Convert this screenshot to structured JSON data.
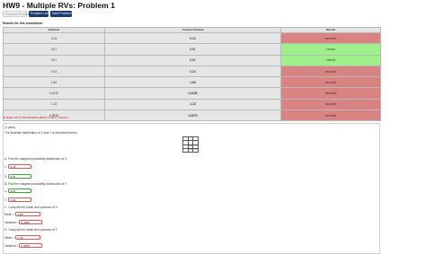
{
  "page": {
    "title": "HW9 - Multiple RVs: Problem 1"
  },
  "nav": {
    "previous_label": "Previous Problem",
    "list_label": "Problem List",
    "next_label": "Next Problem"
  },
  "results": {
    "heading": "Results for this submission",
    "columns": [
      "Entered",
      "Answer Preview",
      "Result"
    ],
    "rows": [
      {
        "entered": "0.24",
        "preview": "0.24",
        "result": "incorrect"
      },
      {
        "entered": "0.67",
        "preview": "0.67",
        "result": "correct"
      },
      {
        "entered": "0.67",
        "preview": "0.67",
        "result": "correct"
      },
      {
        "entered": "0.24",
        "preview": "0.24",
        "result": "incorrect"
      },
      {
        "entered": "1.65",
        "preview": "1.65",
        "result": "incorrect"
      },
      {
        "entered": "0.4235",
        "preview": "0.4235",
        "result": "incorrect"
      },
      {
        "entered": "1.15",
        "preview": "1.15",
        "result": "incorrect"
      },
      {
        "entered": "0.3575",
        "preview": "0.3575",
        "result": "incorrect"
      }
    ],
    "score_note": "At least one of the answers above is NOT correct."
  },
  "problem": {
    "points": "(1 point)",
    "intro": "The bivariate distribution of X and Y is described below:",
    "joint_table": [
      [
        "",
        "X",
        ""
      ],
      [
        "",
        "1",
        "2"
      ],
      [
        "Y",
        "0.23",
        "0.1"
      ],
      [
        "",
        "0.44",
        "0.23"
      ]
    ],
    "part_a": "A. Find the marginal probability distribution of X:",
    "a_labels": [
      "1:",
      "2:"
    ],
    "a_values": [
      "0.24",
      "0.67"
    ],
    "part_b": "B. Find the marginal probability distribution of Y:",
    "b_labels": [
      "1:",
      "2:"
    ],
    "b_values": [
      "0.67",
      "0.24"
    ],
    "part_c": "C. Compute the mean and variance of X.",
    "c_mean_label": "Mean =",
    "c_mean_value": "1.65",
    "c_var_label": "Variance =",
    "c_var_value": "0.4235",
    "part_d": "D. Compute the mean and variance of Y.",
    "d_mean_label": "Mean =",
    "d_mean_value": "1.15",
    "d_var_label": "Variance =",
    "d_var_value": "0.3575"
  },
  "colors": {
    "correct": "#9ef08a",
    "incorrect": "#d98383",
    "nav_button": "#1b3a72",
    "warning_text": "#c0302a"
  }
}
